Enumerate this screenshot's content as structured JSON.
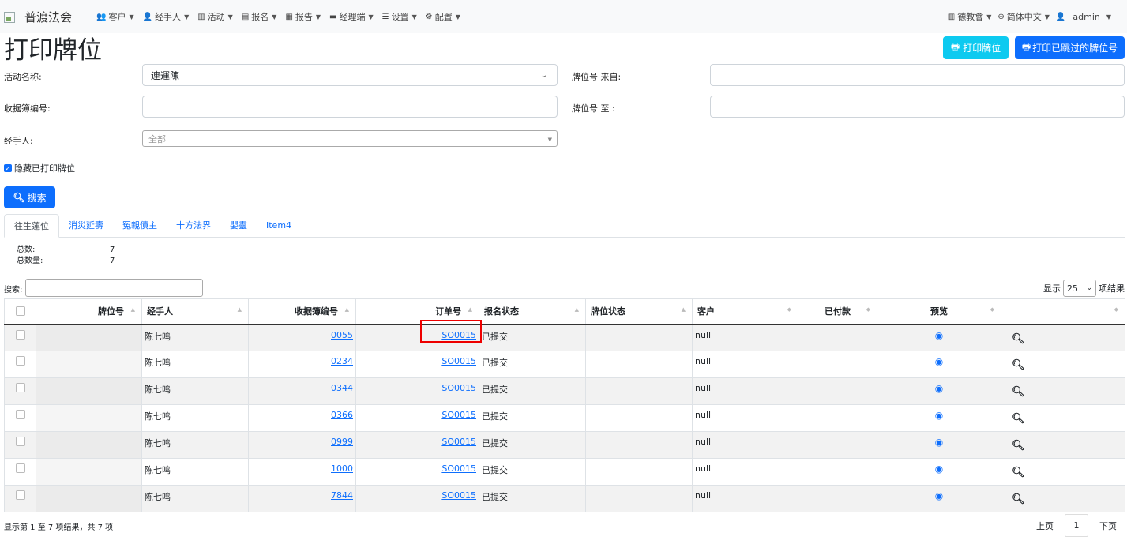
{
  "brand": {
    "title": "普渡法会"
  },
  "nav": {
    "items": [
      {
        "label": "客户",
        "icon": "users-icon"
      },
      {
        "label": "经手人",
        "icon": "user-icon"
      },
      {
        "label": "活动",
        "icon": "map-icon"
      },
      {
        "label": "报名",
        "icon": "list-icon"
      },
      {
        "label": "报告",
        "icon": "file-icon"
      },
      {
        "label": "经理端",
        "icon": "briefcase-icon"
      },
      {
        "label": "设置",
        "icon": "sliders-icon"
      },
      {
        "label": "配置",
        "icon": "gear-icon"
      }
    ],
    "right": [
      {
        "label": "德教會",
        "icon": "building-icon"
      },
      {
        "label": "简体中文",
        "icon": "globe-icon"
      },
      {
        "label": "admin",
        "icon": "user-icon"
      }
    ]
  },
  "page": {
    "title": "打印牌位",
    "print_btn": "打印牌位",
    "print_skipped_btn": "打印已跳过的牌位号"
  },
  "form": {
    "activity_label": "活动名称:",
    "activity_value": "連運陳",
    "receipt_label": "收据簿编号:",
    "receipt_value": "",
    "handler_label": "经手人:",
    "handler_value": "全部",
    "from_label": "牌位号 来自:",
    "from_value": "",
    "to_label": "牌位号 至 :",
    "to_value": "",
    "hide_printed_label": "隐藏已打印牌位",
    "hide_printed_checked": true,
    "search_btn": "搜索"
  },
  "tabs": [
    {
      "label": "往生蓮位",
      "active": true
    },
    {
      "label": "消災延壽",
      "active": false
    },
    {
      "label": "冤親債主",
      "active": false
    },
    {
      "label": "十方法界",
      "active": false
    },
    {
      "label": "嬰靈",
      "active": false
    },
    {
      "label": "Item4",
      "active": false
    }
  ],
  "stats": {
    "total_label": "总数:",
    "total_value": "7",
    "qty_label": "总数量:",
    "qty_value": "7"
  },
  "table_controls": {
    "search_label": "搜索:",
    "show_label": "显示",
    "page_size": "25",
    "results_label": "项结果"
  },
  "table": {
    "columns": [
      "",
      "牌位号",
      "经手人",
      "收据簿编号",
      "订单号",
      "报名状态",
      "牌位状态",
      "客户",
      "已付款",
      "预览",
      ""
    ],
    "rows": [
      {
        "pai": "",
        "handler": "陈七鸣",
        "receipt": "0055",
        "order": "SO0015",
        "status": "已提交",
        "pai_status": "",
        "customer": "null",
        "paid": ""
      },
      {
        "pai": "",
        "handler": "陈七鸣",
        "receipt": "0234",
        "order": "SO0015",
        "status": "已提交",
        "pai_status": "",
        "customer": "null",
        "paid": ""
      },
      {
        "pai": "",
        "handler": "陈七鸣",
        "receipt": "0344",
        "order": "SO0015",
        "status": "已提交",
        "pai_status": "",
        "customer": "null",
        "paid": ""
      },
      {
        "pai": "",
        "handler": "陈七鸣",
        "receipt": "0366",
        "order": "SO0015",
        "status": "已提交",
        "pai_status": "",
        "customer": "null",
        "paid": ""
      },
      {
        "pai": "",
        "handler": "陈七鸣",
        "receipt": "0999",
        "order": "SO0015",
        "status": "已提交",
        "pai_status": "",
        "customer": "null",
        "paid": ""
      },
      {
        "pai": "",
        "handler": "陈七鸣",
        "receipt": "1000",
        "order": "SO0015",
        "status": "已提交",
        "pai_status": "",
        "customer": "null",
        "paid": ""
      },
      {
        "pai": "",
        "handler": "陈七鸣",
        "receipt": "7844",
        "order": "SO0015",
        "status": "已提交",
        "pai_status": "",
        "customer": "null",
        "paid": ""
      }
    ]
  },
  "footer": {
    "info": "显示第 1 至 7 项结果，共 7 项",
    "prev": "上页",
    "page": "1",
    "next": "下页"
  },
  "colors": {
    "primary": "#0d6efd",
    "info": "#0dcaf0",
    "highlight": "#ee0000"
  }
}
